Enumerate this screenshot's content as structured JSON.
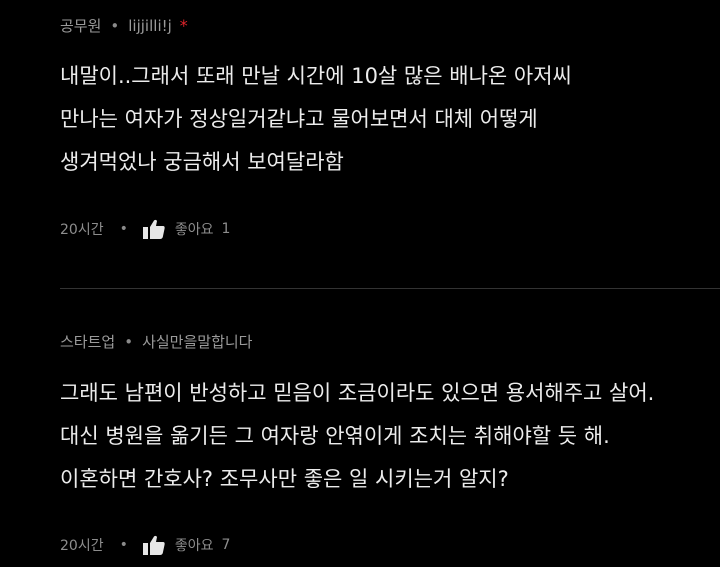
{
  "comments": [
    {
      "author": "공무원",
      "author_tag": "lijjilli!j",
      "star": "*",
      "lines": [
        "내말이..그래서 또래 만날 시간에 10살 많은 배나온 아저씨",
        "만나는 여자가 정상일거같냐고 물어보면서 대체 어떻게",
        "생겨먹었나 궁금해서 보여달라함"
      ],
      "time": "20시간",
      "like_label": "좋아요",
      "like_count": "1"
    },
    {
      "author": "스타트업",
      "author_tag": "사실만을말합니다",
      "lines": [
        "그래도 남편이 반성하고 믿음이 조금이라도 있으면 용서해주고 살어.",
        "대신 병원을 옮기든 그 여자랑 안엮이게 조치는 취해야할 듯 해.",
        "이혼하면 간호사? 조무사만 좋은 일 시키는거 알지?"
      ],
      "time": "20시간",
      "like_label": "좋아요",
      "like_count": "7"
    }
  ],
  "separator": "•",
  "icons": {
    "like": "thumbs-up-icon"
  },
  "colors": {
    "background": "#000000",
    "text": "#ececec",
    "meta": "#9a9a9a",
    "star": "#e0252b",
    "divider": "#333333"
  }
}
